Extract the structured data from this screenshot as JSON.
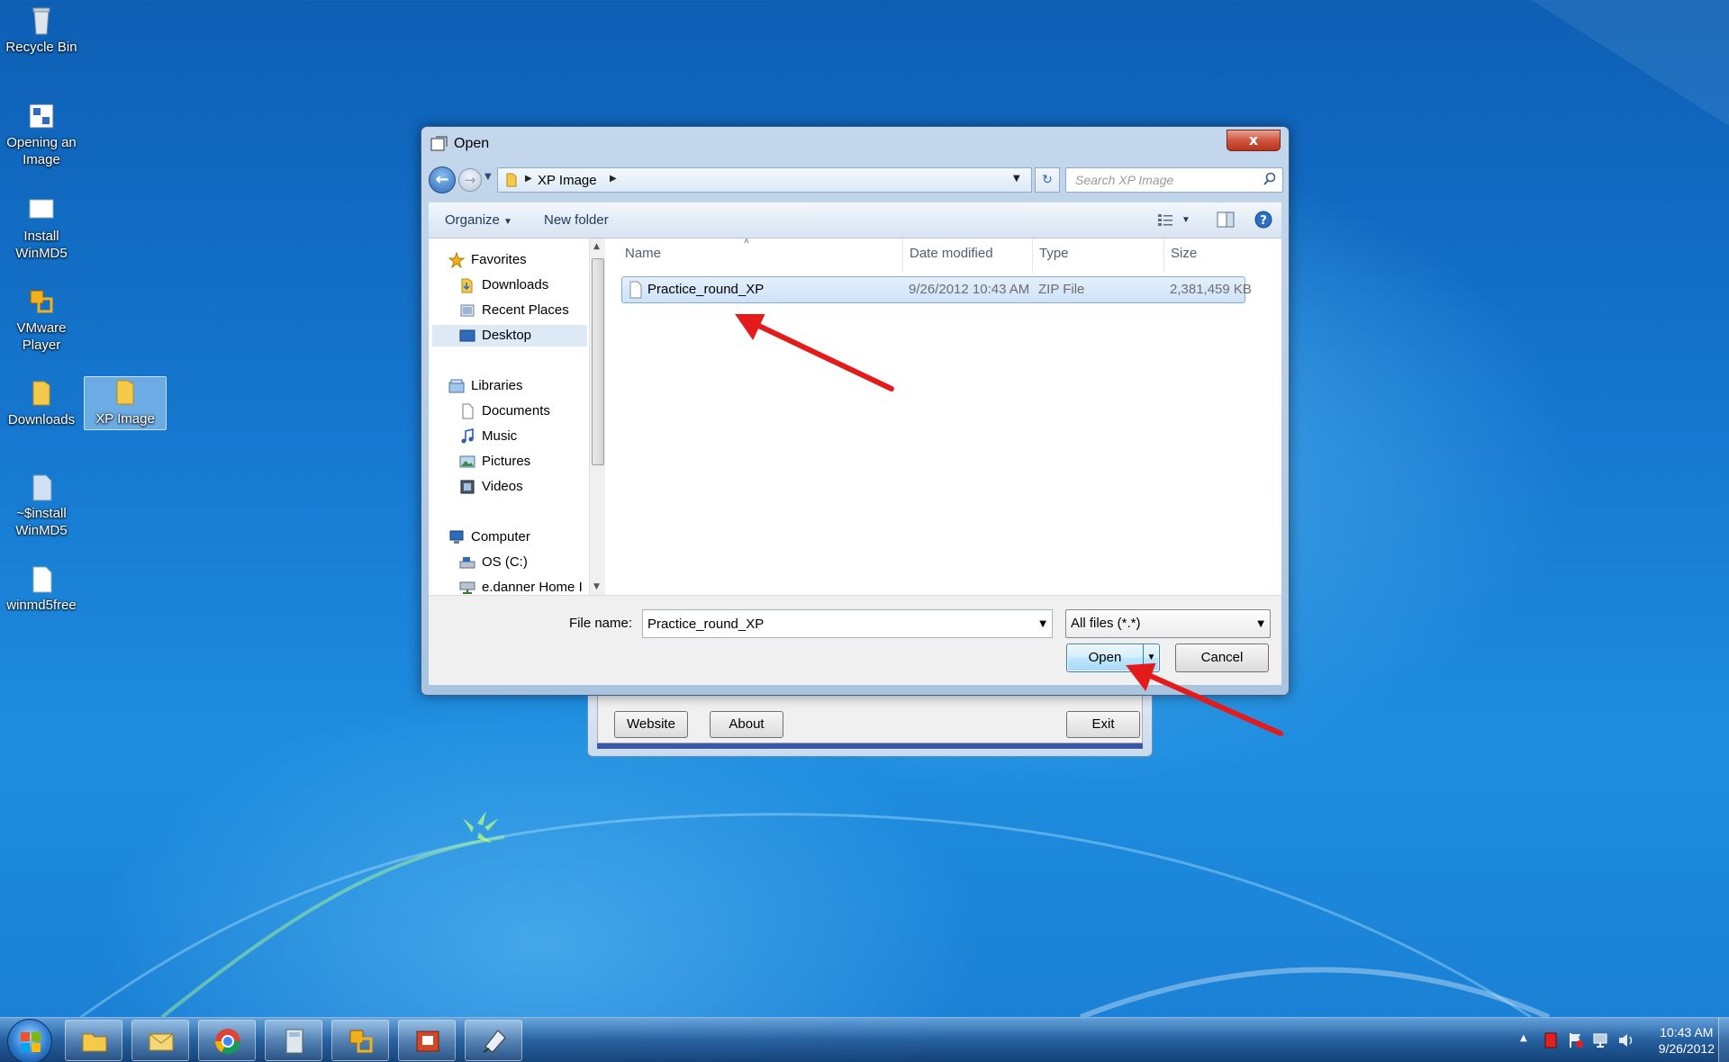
{
  "desktop": {
    "icons": [
      {
        "label": "Recycle Bin",
        "icon": "recycle-bin-icon"
      },
      {
        "label": "Opening an Image",
        "icon": "shortcut-icon"
      },
      {
        "label": "Install WinMD5",
        "icon": "installer-icon"
      },
      {
        "label": "VMware Player",
        "icon": "vmware-icon"
      },
      {
        "label": "Downloads",
        "icon": "folder-icon"
      },
      {
        "label": "XP Image",
        "icon": "folder-icon"
      },
      {
        "label": "~$install WinMD5",
        "icon": "document-icon"
      },
      {
        "label": "winmd5free",
        "icon": "document-icon"
      }
    ]
  },
  "background_app": {
    "website_label": "Website",
    "about_label": "About",
    "exit_label": "Exit"
  },
  "dialog": {
    "title": "Open",
    "close_label": "x",
    "address": {
      "crumb": "XP Image"
    },
    "search": {
      "placeholder": "Search XP Image"
    },
    "toolbar": {
      "organize_label": "Organize",
      "new_folder_label": "New folder"
    },
    "nav": {
      "favorites": "Favorites",
      "downloads": "Downloads",
      "recent_places": "Recent Places",
      "desktop": "Desktop",
      "libraries": "Libraries",
      "documents": "Documents",
      "music": "Music",
      "pictures": "Pictures",
      "videos": "Videos",
      "computer": "Computer",
      "os_c": "OS (C:)",
      "home": "e.danner Home I"
    },
    "columns": {
      "name": "Name",
      "date_modified": "Date modified",
      "type": "Type",
      "size": "Size"
    },
    "files": [
      {
        "name": "Practice_round_XP",
        "date_modified": "9/26/2012 10:43 AM",
        "type": "ZIP File",
        "size": "2,381,459 KB"
      }
    ],
    "file_name_label": "File name:",
    "file_name_value": "Practice_round_XP",
    "file_type_value": "All files (*.*)",
    "open_label": "Open",
    "cancel_label": "Cancel"
  },
  "taskbar": {
    "pinned": [
      "explorer-icon",
      "outlook-icon",
      "chrome-icon",
      "calculator-icon",
      "vmware-icon",
      "presentation-icon",
      "app-icon"
    ],
    "clock_time": "10:43 AM",
    "clock_date": "9/26/2012"
  },
  "annotations": {
    "arrow_color": "#e31b1b"
  }
}
